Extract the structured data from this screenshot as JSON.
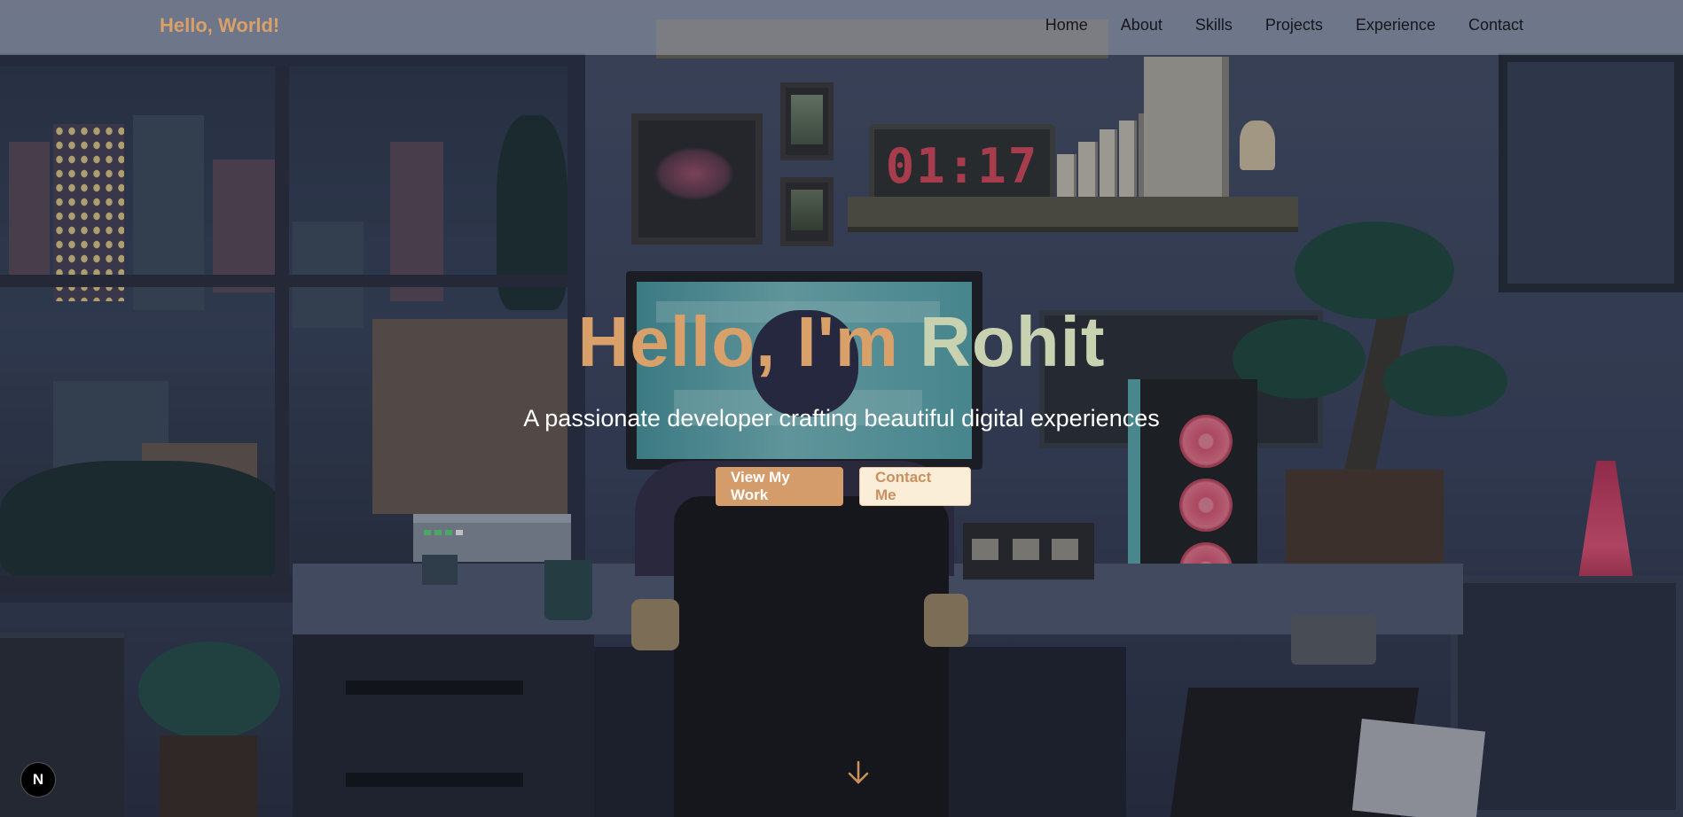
{
  "brand": "Hello, World!",
  "nav": {
    "items": [
      "Home",
      "About",
      "Skills",
      "Projects",
      "Experience",
      "Contact"
    ]
  },
  "hero": {
    "title_part1": "Hello, I'm ",
    "title_part2": "Rohit",
    "subtitle": "A passionate developer crafting beautiful digital experiences",
    "primary_button": "View My Work",
    "secondary_button": "Contact Me"
  },
  "scene": {
    "clock_time": "01:17"
  },
  "badge": {
    "label": "N"
  },
  "icons": {
    "scroll": "arrow-down-icon",
    "framework": "nextjs-badge-icon"
  },
  "colors": {
    "brand_accent": "#d9a06a",
    "title_highlight": "#c9d2b0",
    "primary_button_bg": "#d49c6a",
    "secondary_button_bg": "#fbeed9"
  }
}
